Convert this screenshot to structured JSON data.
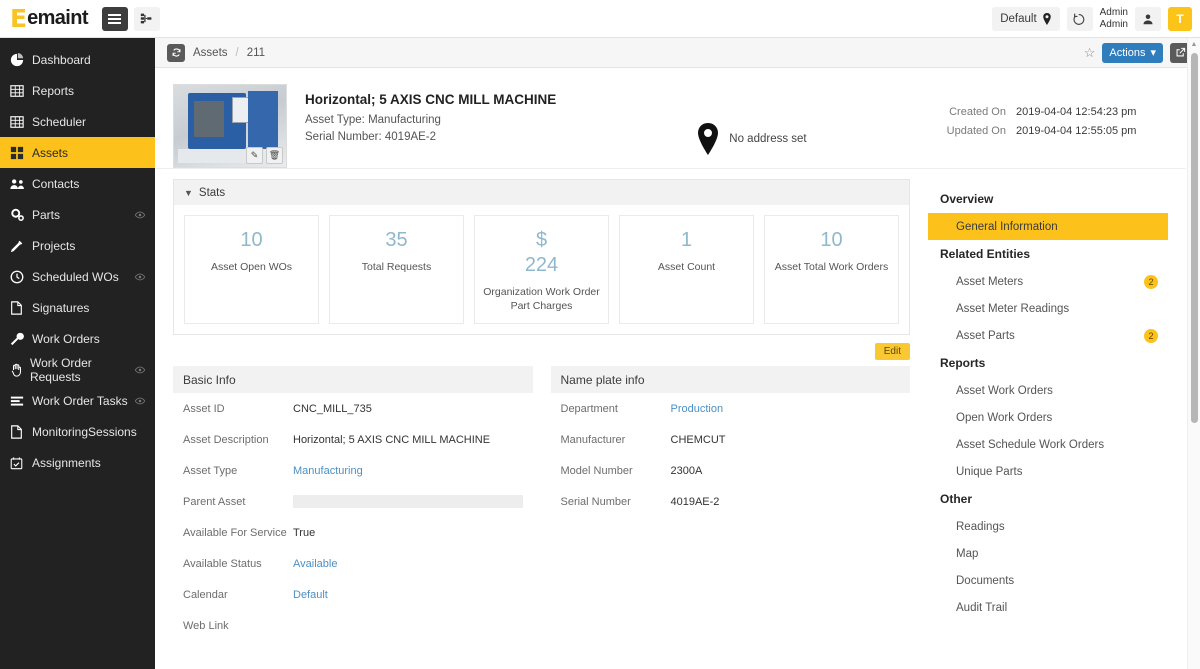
{
  "topbar": {
    "brand_initial": "E",
    "brand_text": "emaint",
    "menu_icon": "hamburger-icon",
    "org_icon": "org-chart-icon",
    "default_label": "Default",
    "location_icon": "location-pin-icon",
    "history_icon": "history-undo-icon",
    "user_line1": "Admin",
    "user_line2": "Admin",
    "person_icon": "person-icon",
    "avatar_initial": "T",
    "accent_yellow": "#fcc21b"
  },
  "sidebar": {
    "items": [
      {
        "label": "Dashboard",
        "icon": "pie-chart-icon",
        "active": false,
        "eye": false
      },
      {
        "label": "Reports",
        "icon": "table-icon",
        "active": false,
        "eye": false
      },
      {
        "label": "Scheduler",
        "icon": "calendar-grid-icon",
        "active": false,
        "eye": false
      },
      {
        "label": "Assets",
        "icon": "grid-squares-icon",
        "active": true,
        "eye": false
      },
      {
        "label": "Contacts",
        "icon": "people-icon",
        "active": false,
        "eye": false
      },
      {
        "label": "Parts",
        "icon": "gears-icon",
        "active": false,
        "eye": true
      },
      {
        "label": "Projects",
        "icon": "pencil-icon",
        "active": false,
        "eye": false
      },
      {
        "label": "Scheduled WOs",
        "icon": "clock-icon",
        "active": false,
        "eye": true
      },
      {
        "label": "Signatures",
        "icon": "document-icon",
        "active": false,
        "eye": false
      },
      {
        "label": "Work Orders",
        "icon": "wrench-icon",
        "active": false,
        "eye": false
      },
      {
        "label": "Work Order Requests",
        "icon": "hand-icon",
        "active": false,
        "eye": true
      },
      {
        "label": "Work Order Tasks",
        "icon": "list-lines-icon",
        "active": false,
        "eye": true
      },
      {
        "label": "MonitoringSessions",
        "icon": "document-icon",
        "active": false,
        "eye": false
      },
      {
        "label": "Assignments",
        "icon": "calendar-check-icon",
        "active": false,
        "eye": false
      }
    ]
  },
  "breadcrumb": {
    "refresh_icon": "refresh-icon",
    "root": "Assets",
    "separator": "/",
    "current": "211",
    "star_icon": "star-outline-icon",
    "actions_label": "Actions",
    "actions_caret": "▾",
    "share_icon": "external-link-icon"
  },
  "asset": {
    "thumbnail_alt": "cnc-mill-photo",
    "edit_photo_icon": "pencil-icon",
    "delete_photo_icon": "trash-icon",
    "title": "Horizontal; 5 AXIS CNC MILL MACHINE",
    "asset_type_line": "Asset Type: Manufacturing",
    "serial_line": "Serial Number:  4019AE-2",
    "address_icon": "location-pin-icon",
    "address_text": "No address set",
    "created_on_label": "Created On",
    "created_on_value": "2019-04-04 12:54:23 pm",
    "updated_on_label": "Updated On",
    "updated_on_value": "2019-04-04 12:55:05 pm"
  },
  "stats": {
    "header": "Stats",
    "collapse_icon": "chevron-down-icon",
    "cards": [
      {
        "value": "10",
        "label": "Asset Open WOs"
      },
      {
        "value": "35",
        "label": "Total Requests"
      },
      {
        "value": "$\n224",
        "value_line1": "$",
        "value_line2": "224",
        "label": "Organization Work Order Part Charges"
      },
      {
        "value": "1",
        "label": "Asset Count"
      },
      {
        "value": "10",
        "label": "Asset Total Work Orders"
      }
    ]
  },
  "edit_button": {
    "label": "Edit"
  },
  "basic_info": {
    "header": "Basic Info",
    "fields": [
      {
        "label": "Asset ID",
        "value": "CNC_MILL_735",
        "type": "text"
      },
      {
        "label": "Asset Description",
        "value": "Horizontal; 5 AXIS CNC MILL MACHINE",
        "type": "text"
      },
      {
        "label": "Asset Type",
        "value": "Manufacturing",
        "type": "link"
      },
      {
        "label": "Parent Asset",
        "value": "",
        "type": "input"
      },
      {
        "label": "Available For Service",
        "value": "True",
        "type": "text"
      },
      {
        "label": "Available Status",
        "value": "Available",
        "type": "link"
      },
      {
        "label": "Calendar",
        "value": "Default",
        "type": "link"
      },
      {
        "label": "Web Link",
        "value": "",
        "type": "text"
      }
    ]
  },
  "name_plate_info": {
    "header": "Name plate info",
    "fields": [
      {
        "label": "Department",
        "value": "Production",
        "type": "link"
      },
      {
        "label": "Manufacturer",
        "value": "CHEMCUT",
        "type": "text"
      },
      {
        "label": "Model Number",
        "value": "2300A",
        "type": "text"
      },
      {
        "label": "Serial Number",
        "value": "4019AE-2",
        "type": "text"
      }
    ]
  },
  "right_nav": {
    "groups": [
      {
        "title": "Overview",
        "items": [
          {
            "label": "General Information",
            "active": true,
            "badge": ""
          }
        ]
      },
      {
        "title": "Related Entities",
        "items": [
          {
            "label": "Asset Meters",
            "active": false,
            "badge": "2"
          },
          {
            "label": "Asset Meter Readings",
            "active": false,
            "badge": ""
          },
          {
            "label": "Asset Parts",
            "active": false,
            "badge": "2"
          }
        ]
      },
      {
        "title": "Reports",
        "items": [
          {
            "label": "Asset Work Orders",
            "active": false,
            "badge": ""
          },
          {
            "label": "Open Work Orders",
            "active": false,
            "badge": ""
          },
          {
            "label": "Asset Schedule Work Orders",
            "active": false,
            "badge": ""
          },
          {
            "label": "Unique Parts",
            "active": false,
            "badge": ""
          }
        ]
      },
      {
        "title": "Other",
        "items": [
          {
            "label": "Readings",
            "active": false,
            "badge": ""
          },
          {
            "label": "Map",
            "active": false,
            "badge": ""
          },
          {
            "label": "Documents",
            "active": false,
            "badge": ""
          },
          {
            "label": "Audit Trail",
            "active": false,
            "badge": ""
          }
        ]
      }
    ]
  },
  "scrollbar": {
    "up_arrow": "▲"
  }
}
